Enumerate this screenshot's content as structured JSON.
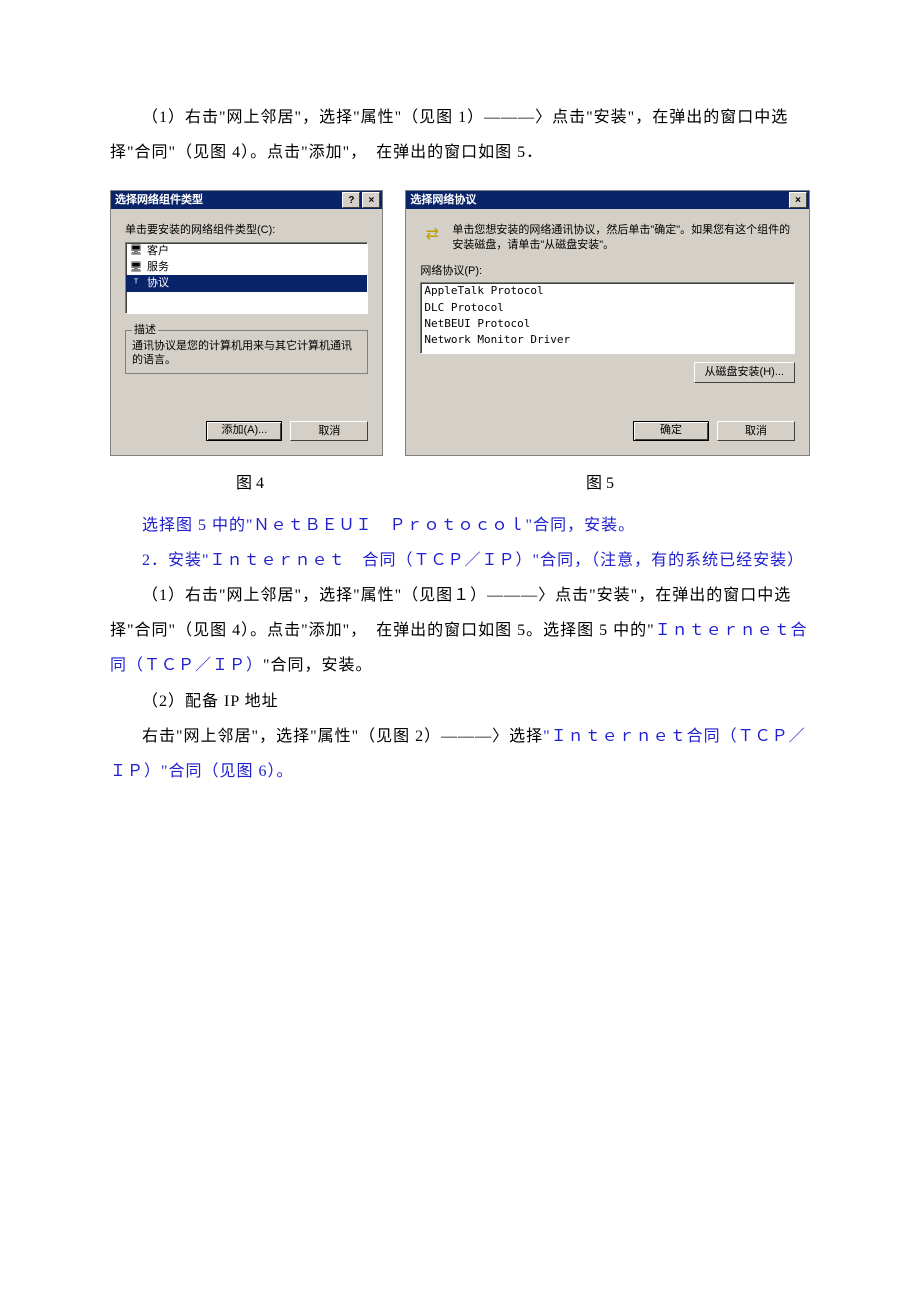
{
  "body": {
    "p1": "（1）右击\"网上邻居\"，选择\"属性\"（见图 1）———〉点击\"安装\"，在弹出的窗口中选择\"合同\"（见图 4）。点击\"添加\"，　在弹出的窗口如图 5．",
    "p2a": "选择",
    "p2b": "图 5 中的\"ＮｅｔＢＥＵＩ　Ｐｒｏｔｏｃｏｌ\"合同，安装。",
    "p3": "2．安装\"Ｉｎｔｅｒｎｅｔ　合同（ＴＣＰ／ＩＰ）\"合同，（注意，有的系统已经安装）",
    "p4a": "（1）右击\"网上邻居\"，选择\"属性\"（见图１）———〉点击\"安装\"，在弹出的窗口中选择\"合同\"（见图 4）。点击\"添加\"，　在弹出的窗口如图 5。选择图 5 中的\"",
    "p4b": "Ｉｎｔｅｒｎｅｔ合同（ＴＣＰ／ＩＰ）",
    "p4c": "\"合同，安装。",
    "p5": "（2）配备 IP 地址",
    "p6a": "右击\"网上邻居\"，选择\"属性\"（见图 2）———〉选择",
    "p6b": "\"Ｉｎｔｅｒｎｅｔ合同（ＴＣＰ／ＩＰ）\"合同",
    "p6c": "（见图 6）。"
  },
  "dialogLeft": {
    "title": "选择网络组件类型",
    "help": "?",
    "close": "×",
    "label": "单击要安装的网络组件类型(C):",
    "items": {
      "client": "客户",
      "service": "服务",
      "protocol": "协议"
    },
    "descLegend": "描述",
    "descText": "通讯协议是您的计算机用来与其它计算机通讯的语言。",
    "addBtn": "添加(A)...",
    "cancelBtn": "取消"
  },
  "dialogRight": {
    "title": "选择网络协议",
    "close": "×",
    "hint": "单击您想安装的网络通讯协议，然后单击\"确定\"。如果您有这个组件的安装磁盘，请单击\"从磁盘安装\"。",
    "listLabel": "网络协议(P):",
    "items": {
      "apple": "AppleTalk Protocol",
      "dlc": "DLC Protocol",
      "netbeui": "NetBEUI Protocol",
      "netmon": "Network Monitor Driver"
    },
    "diskBtn": "从磁盘安装(H)...",
    "okBtn": "确定",
    "cancelBtn": "取消"
  },
  "captions": {
    "fig4": "图 4",
    "fig5": "图 5"
  }
}
